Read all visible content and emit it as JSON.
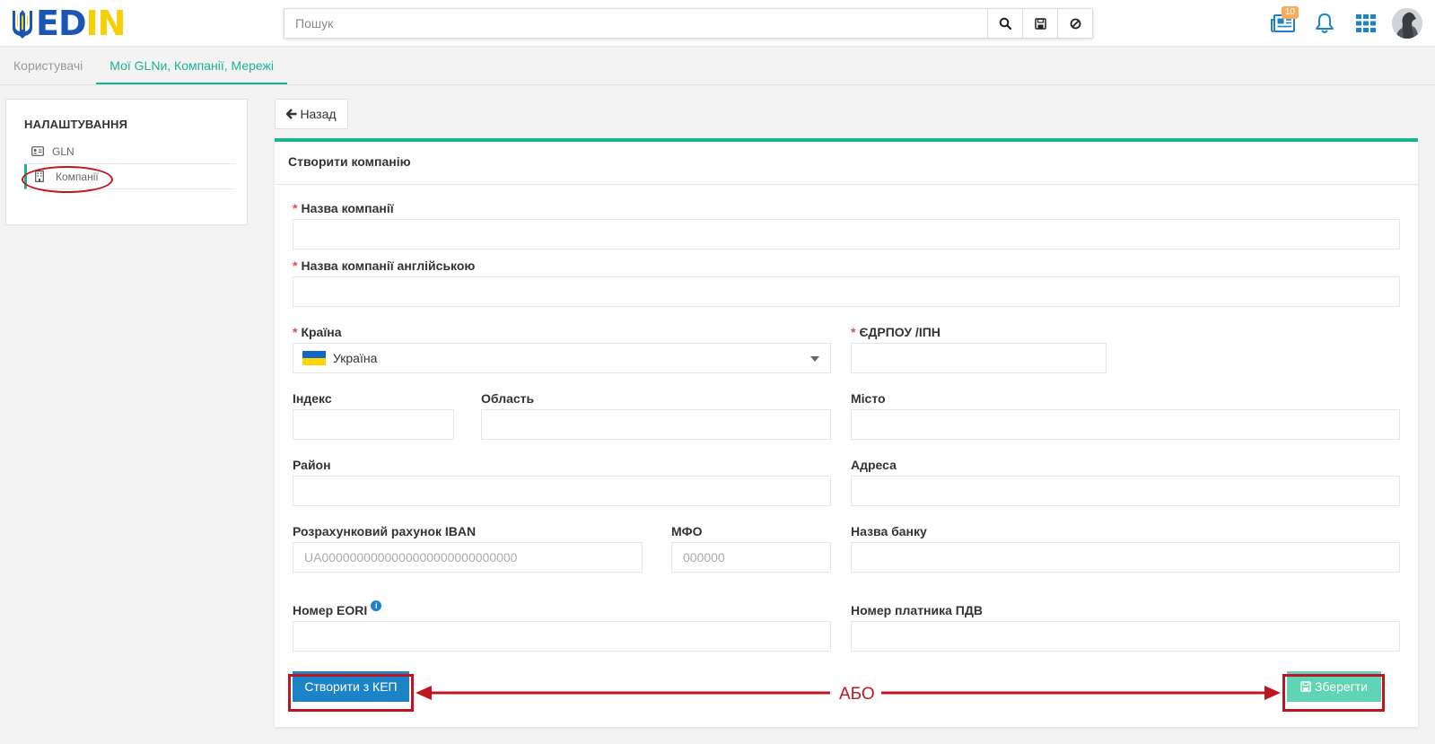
{
  "header": {
    "logo_text_1": "ED",
    "logo_text_2": "IN",
    "search_placeholder": "Пошук",
    "news_badge": "10",
    "icons": [
      "search-icon",
      "save-icon",
      "ban-icon",
      "newspaper-icon",
      "bell-icon",
      "apps-grid-icon",
      "avatar"
    ]
  },
  "tabs": [
    {
      "label": "Користувачі",
      "active": false
    },
    {
      "label": "Мої GLNи, Компанії, Мережі",
      "active": true
    }
  ],
  "sidebar": {
    "title": "НАЛАШТУВАННЯ",
    "items": [
      {
        "label": "GLN",
        "icon": "id-card-icon"
      },
      {
        "label": "Компанії",
        "icon": "building-icon",
        "active": true
      }
    ]
  },
  "back_label": "Назад",
  "form": {
    "title": "Створити компанію",
    "required_mark": "*",
    "fields": {
      "company_name": {
        "label": "Назва компанії",
        "value": ""
      },
      "company_name_en": {
        "label": "Назва компанії англійською",
        "value": ""
      },
      "country": {
        "label": "Країна",
        "value": "Україна"
      },
      "edrpou": {
        "label": "ЄДРПОУ /ІПН",
        "value": ""
      },
      "index": {
        "label": "Індекс",
        "value": ""
      },
      "region": {
        "label": "Область",
        "value": ""
      },
      "city": {
        "label": "Місто",
        "value": ""
      },
      "district": {
        "label": "Район",
        "value": ""
      },
      "address": {
        "label": "Адреса",
        "value": ""
      },
      "iban": {
        "label": "Розрахунковий рахунок IBAN",
        "placeholder": "UA0000000000000000000000000000"
      },
      "mfo": {
        "label": "МФО",
        "placeholder": "000000"
      },
      "bank": {
        "label": "Назва банку",
        "value": ""
      },
      "eori": {
        "label": "Номер EORI",
        "value": ""
      },
      "vat": {
        "label": "Номер платника ПДВ",
        "value": ""
      }
    },
    "create_kep_label": "Створити з КЕП",
    "save_label": "Зберегти"
  },
  "annotation": {
    "or_text": "АБО",
    "color": "#c0151f"
  },
  "colors": {
    "accent": "#1ab394",
    "primary": "#1c84c6",
    "save": "#5fd4b6",
    "badge": "#f8ac59"
  }
}
